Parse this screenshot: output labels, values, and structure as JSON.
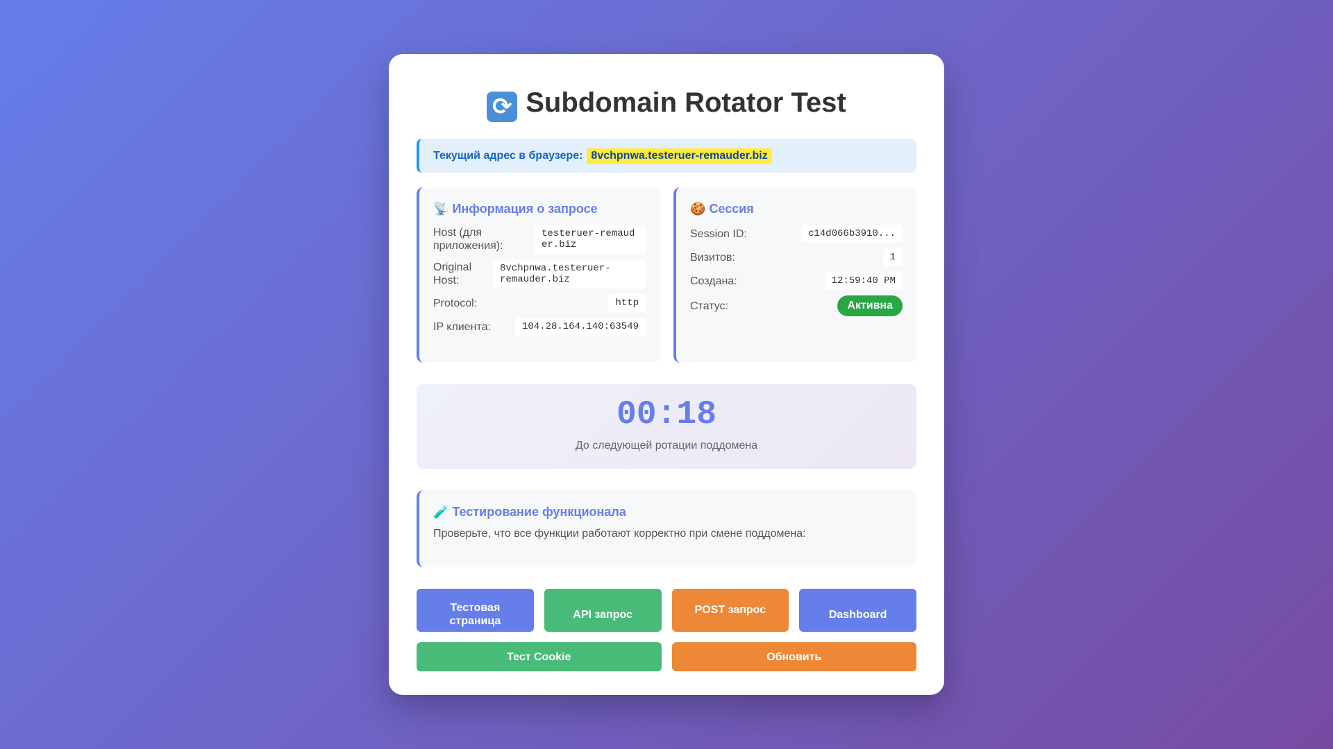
{
  "page": {
    "title_icon": "🔄",
    "title": "Subdomain Rotator Test"
  },
  "current_url": {
    "label": "Текущий адрес в браузере:",
    "value": "8vchpnwa.testeruer-remauder.biz"
  },
  "request_info": {
    "icon": "📡",
    "title": "Информация о запросе",
    "rows": [
      {
        "label": "Host (для приложения):",
        "value": "testeruer-remauder.biz"
      },
      {
        "label": "Original Host:",
        "value": "8vchpnwa.testeruer-remauder.biz"
      },
      {
        "label": "Protocol:",
        "value": "http"
      },
      {
        "label": "IP клиента:",
        "value": "104.28.164.140:63549"
      }
    ]
  },
  "session": {
    "icon": "🍪",
    "title": "Сессия",
    "rows": [
      {
        "label": "Session ID:",
        "value": "c14d066b3910..."
      },
      {
        "label": "Визитов:",
        "value": "1"
      },
      {
        "label": "Создана:",
        "value": "12:59:40 PM"
      }
    ],
    "status_label": "Статус:",
    "status_value": "Активна"
  },
  "timer": {
    "value": "00:18",
    "caption": "До следующей ротации поддомена"
  },
  "testing": {
    "icon": "🧪",
    "title": "Тестирование функционала",
    "text": "Проверьте, что все функции работают корректно при смене поддомена:"
  },
  "buttons": {
    "test_page": "Тестовая страница",
    "api": "API запрос",
    "post": "POST запрос",
    "dashboard": "Dashboard",
    "cookie": "Тест Cookie",
    "refresh": "Обновить"
  },
  "colors": {
    "background_start": "#667eea",
    "background_end": "#764ba2",
    "accent": "#667eea",
    "green": "#48bb78",
    "orange": "#ed8936",
    "status_active": "#28a745",
    "highlight": "#ffeb3b"
  }
}
